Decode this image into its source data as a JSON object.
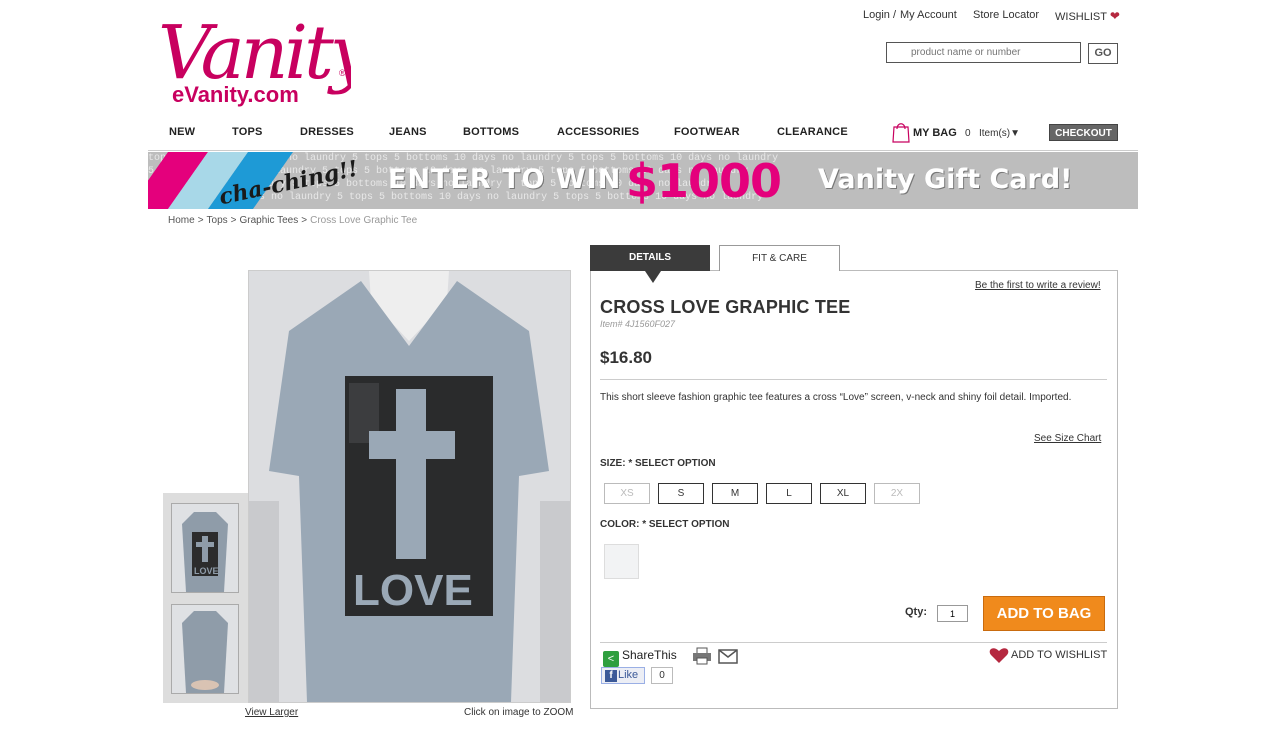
{
  "header": {
    "brand": "Vanity",
    "sub_brand": "eVanity.com",
    "login": "Login /",
    "my_account": "My Account",
    "store_locator": "Store Locator",
    "wishlist": "WISHLIST",
    "search_placeholder": "product name or number",
    "go_label": "GO"
  },
  "nav": {
    "items": [
      "NEW",
      "TOPS",
      "DRESSES",
      "JEANS",
      "BOTTOMS",
      "ACCESSORIES",
      "FOOTWEAR",
      "CLEARANCE"
    ],
    "bag_label": "MY BAG",
    "bag_count": "0",
    "bag_items": "Item(s)▼",
    "checkout": "CHECKOUT"
  },
  "banner": {
    "tagline": "cha-ching!!",
    "enter": "ENTER TO WIN",
    "amount": "$1000",
    "card": "Vanity Gift Card!",
    "background_text": "tops 5 bottoms 10 days no laundry 5 tops 5 bottoms 10 days no laundry 5 tops 5 bottoms 10 days no laundry"
  },
  "breadcrumb": {
    "items": [
      "Home",
      "Tops",
      "Graphic Tees"
    ],
    "current": "Cross Love Graphic Tee"
  },
  "gallery": {
    "view_larger": "View Larger",
    "zoom_hint": "Click on image to ZOOM",
    "shirt_text": "LOVE"
  },
  "details": {
    "tab_details": "DETAILS",
    "tab_fit": "FIT & CARE",
    "review_link": "Be the first to write a review!",
    "title": "CROSS LOVE GRAPHIC TEE",
    "item_number": "Item# 4J1560F027",
    "price": "$16.80",
    "description": "This short sleeve fashion graphic tee features a cross “Love” screen, v-neck and shiny foil detail. Imported.",
    "size_chart": "See Size Chart",
    "size_label": "SIZE:  * SELECT OPTION",
    "sizes": [
      "XS",
      "S",
      "M",
      "L",
      "XL",
      "2X"
    ],
    "color_label": "COLOR:  * SELECT OPTION",
    "qty_label": "Qty:",
    "qty_value": "1",
    "add_to_bag": "ADD TO BAG",
    "share_this": "ShareThis",
    "add_wishlist": "ADD TO WISHLIST",
    "fb_like": "Like",
    "fb_count": "0"
  },
  "colors": {
    "brand_pink": "#c8005f",
    "add_to_bag_orange": "#f08a1c",
    "tab_dark": "#3b3b3b"
  }
}
